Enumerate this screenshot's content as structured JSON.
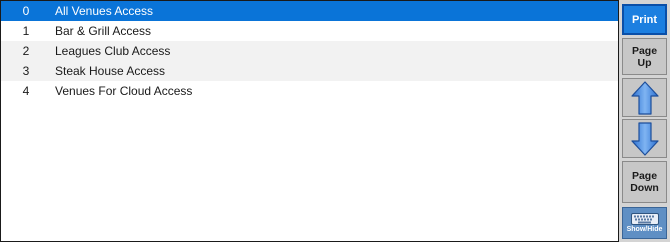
{
  "list": {
    "rows": [
      {
        "num": "0",
        "name": "All Venues Access"
      },
      {
        "num": "1",
        "name": "Bar & Grill Access"
      },
      {
        "num": "2",
        "name": "Leagues Club Access"
      },
      {
        "num": "3",
        "name": "Steak House Access"
      },
      {
        "num": "4",
        "name": "Venues For Cloud Access"
      }
    ]
  },
  "side": {
    "print": "Print",
    "page_up_line1": "Page",
    "page_up_line2": "Up",
    "page_down_line1": "Page",
    "page_down_line2": "Down",
    "show_hide": "Show/Hide"
  },
  "colors": {
    "selected": "#0a74d8",
    "accent": "#1c7fe0",
    "arrow": "#4a8de0"
  },
  "icons": [
    "arrow-up-icon",
    "arrow-down-icon",
    "keyboard-icon"
  ]
}
